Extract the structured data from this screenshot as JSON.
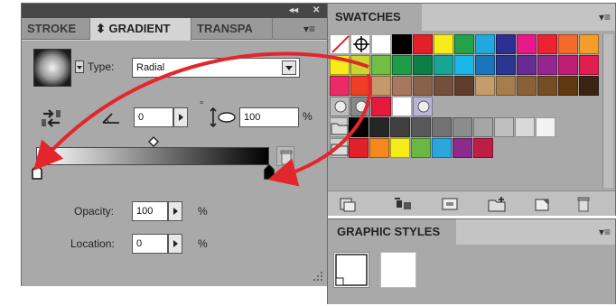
{
  "gradient_panel": {
    "tabs": [
      "STROKE",
      "⬍ GRADIENT",
      "TRANSPA"
    ],
    "type_label": "Type:",
    "type_value": "Radial",
    "angle_value": "0",
    "degree_symbol": "°",
    "aspect_value": "100",
    "aspect_unit": "%",
    "opacity_label": "Opacity:",
    "opacity_value": "100",
    "opacity_unit": "%",
    "location_label": "Location:",
    "location_value": "0",
    "location_unit": "%",
    "collapse_glyph": "◂◂",
    "close_glyph": "✕",
    "menu_glyph": "▾≡"
  },
  "swatches_panel": {
    "title": "SWATCHES",
    "menu_glyph": "▾≡",
    "rows": [
      [
        "none",
        "registration",
        "#ffffff",
        "#000000",
        "#e3202a",
        "#f7ec1a",
        "#23a24a",
        "#21a8df",
        "#2d3090",
        "#e8188a",
        "#ec2233",
        "#f46a28",
        "#f59d2a"
      ],
      [
        "#f7ec1a",
        "#c8d62d",
        "#72be44",
        "#1f9c4a",
        "#0b7f45",
        "#16a597",
        "#1ab7e9",
        "#1b75bc",
        "#2a3791",
        "#662c91",
        "#92278f",
        "#be1e74",
        "#e21d4f"
      ],
      [
        "#ec2a66",
        "#ee3e25",
        "#c49a6c",
        "#a8785e",
        "#8a6249",
        "#734f3c",
        "#5f3c2c",
        "#c69c6d",
        "#a57e4e",
        "#8b5f37",
        "#754c24",
        "#603913",
        "#3c2415"
      ],
      [
        "pattern1",
        "pattern2",
        "#e31a3b",
        "#ffffff",
        "pattern3"
      ],
      [
        "folder",
        "#000000",
        "#262626",
        "#404040",
        "#595959",
        "#737373",
        "#8c8c8c",
        "#a6a6a6",
        "#bfbfbf",
        "#d9d9d9",
        "#f2f2f2"
      ],
      [
        "folder",
        "#e3202a",
        "#f5871f",
        "#f7ec1a",
        "#6ab744",
        "#2aa5dd",
        "#8b2b8e",
        "#be1e45"
      ]
    ]
  },
  "graphic_styles_panel": {
    "title": "GRAPHIC STYLES",
    "menu_glyph": "▾≡"
  },
  "colors": {
    "arrow_red": "#e3262d",
    "panel_gray": "#a9a9a9",
    "tab_active": "#d4d4d4"
  }
}
